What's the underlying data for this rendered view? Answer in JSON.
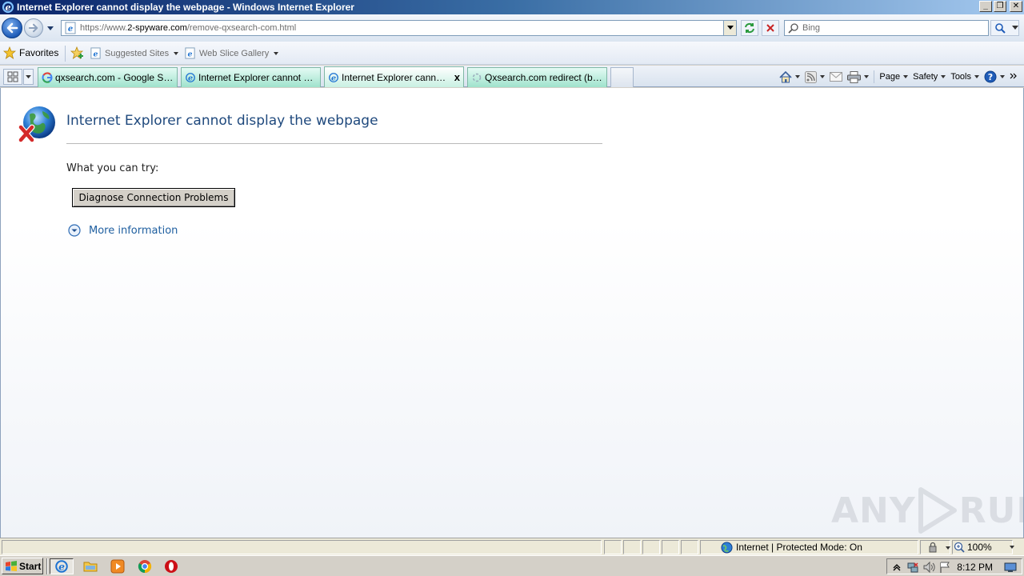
{
  "window": {
    "title": "Internet Explorer cannot display the webpage - Windows Internet Explorer",
    "controls": {
      "minimize": "_",
      "maximize": "❐",
      "close": "✕"
    }
  },
  "addressbar": {
    "url_prefix": "https://www.",
    "url_domain": "2-spyware.com",
    "url_path": "/remove-qxsearch-com.html",
    "search_placeholder": "Bing"
  },
  "favorites_bar": {
    "favorites_label": "Favorites",
    "suggested_sites": "Suggested Sites",
    "web_slice_gallery": "Web Slice Gallery"
  },
  "tabs": [
    {
      "label": "qxsearch.com - Google Search",
      "icon": "google-icon"
    },
    {
      "label": "Internet Explorer cannot dis...",
      "icon": "ie-page-icon"
    },
    {
      "label": "Internet Explorer cannot...",
      "icon": "ie-page-icon",
      "active": true,
      "close": "x"
    },
    {
      "label": "Qxsearch.com redirect (bro...",
      "icon": "loading-icon"
    }
  ],
  "command_bar": {
    "page": "Page",
    "safety": "Safety",
    "tools": "Tools"
  },
  "content": {
    "error_title": "Internet Explorer cannot display the webpage",
    "what_you_can_try": "What you can try:",
    "diagnose_button": "Diagnose Connection Problems",
    "more_information": "More information",
    "watermark_left": "ANY",
    "watermark_right": "RUN"
  },
  "statusbar": {
    "zone": "Internet | Protected Mode: On",
    "zoom": "100%"
  },
  "taskbar": {
    "start": "Start",
    "clock": "8:12 PM"
  },
  "colors": {
    "title_gradient_start": "#0a246a",
    "tab_bg": "#9fe2cc",
    "error_title": "#1f497d",
    "link": "#1f5fa0"
  }
}
